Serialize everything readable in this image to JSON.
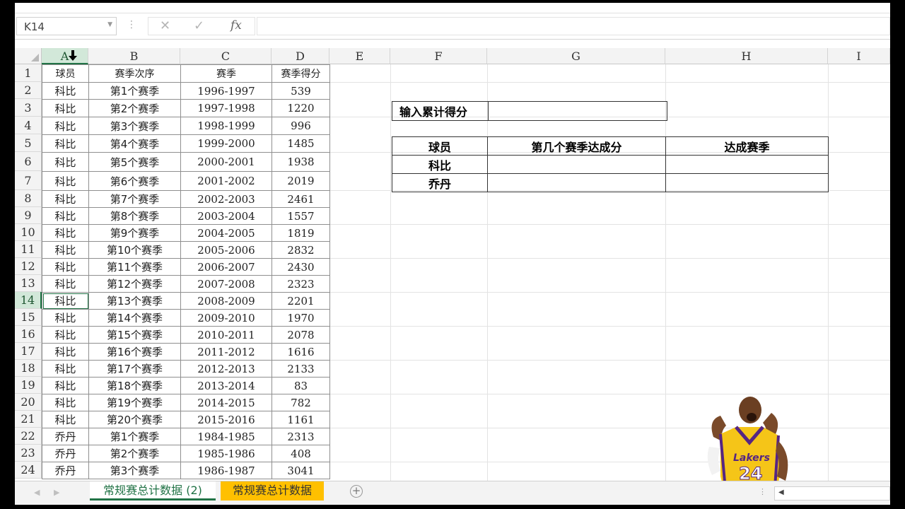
{
  "formula_bar": {
    "name_box": "K14",
    "cancel_glyph": "✕",
    "enter_glyph": "✓",
    "fx_label": "fx",
    "formula": ""
  },
  "columns": [
    "A",
    "B",
    "C",
    "D",
    "E",
    "F",
    "G",
    "H",
    "I"
  ],
  "selected_column": "A",
  "selected_row": 14,
  "rows": [
    "1",
    "2",
    "3",
    "4",
    "5",
    "6",
    "7",
    "8",
    "9",
    "10",
    "11",
    "12",
    "13",
    "14",
    "15",
    "16",
    "17",
    "18",
    "19",
    "20",
    "21",
    "22",
    "23",
    "24"
  ],
  "table": {
    "headers": [
      "球员",
      "赛季次序",
      "赛季",
      "赛季得分"
    ],
    "data": [
      [
        "科比",
        "第1个赛季",
        "1996-1997",
        "539"
      ],
      [
        "科比",
        "第2个赛季",
        "1997-1998",
        "1220"
      ],
      [
        "科比",
        "第3个赛季",
        "1998-1999",
        "996"
      ],
      [
        "科比",
        "第4个赛季",
        "1999-2000",
        "1485"
      ],
      [
        "科比",
        "第5个赛季",
        "2000-2001",
        "1938"
      ],
      [
        "科比",
        "第6个赛季",
        "2001-2002",
        "2019"
      ],
      [
        "科比",
        "第7个赛季",
        "2002-2003",
        "2461"
      ],
      [
        "科比",
        "第8个赛季",
        "2003-2004",
        "1557"
      ],
      [
        "科比",
        "第9个赛季",
        "2004-2005",
        "1819"
      ],
      [
        "科比",
        "第10个赛季",
        "2005-2006",
        "2832"
      ],
      [
        "科比",
        "第11个赛季",
        "2006-2007",
        "2430"
      ],
      [
        "科比",
        "第12个赛季",
        "2007-2008",
        "2323"
      ],
      [
        "科比",
        "第13个赛季",
        "2008-2009",
        "2201"
      ],
      [
        "科比",
        "第14个赛季",
        "2009-2010",
        "1970"
      ],
      [
        "科比",
        "第15个赛季",
        "2010-2011",
        "2078"
      ],
      [
        "科比",
        "第16个赛季",
        "2011-2012",
        "1616"
      ],
      [
        "科比",
        "第17个赛季",
        "2012-2013",
        "2133"
      ],
      [
        "科比",
        "第18个赛季",
        "2013-2014",
        "83"
      ],
      [
        "科比",
        "第19个赛季",
        "2014-2015",
        "782"
      ],
      [
        "科比",
        "第20个赛季",
        "2015-2016",
        "1161"
      ],
      [
        "乔丹",
        "第1个赛季",
        "1984-1985",
        "2313"
      ],
      [
        "乔丹",
        "第2个赛季",
        "1985-1986",
        "408"
      ],
      [
        "乔丹",
        "第3个赛季",
        "1986-1987",
        "3041"
      ]
    ]
  },
  "input_box": {
    "label": "输入累计得分",
    "value": ""
  },
  "result_table": {
    "headers": [
      "球员",
      "第几个赛季达成分",
      "达成赛季"
    ],
    "rows": [
      [
        "科比",
        "",
        ""
      ],
      [
        "乔丹",
        "",
        ""
      ]
    ]
  },
  "player_image": {
    "jersey_number": "24",
    "jersey_text": "Lakers",
    "jersey_color": "#f5c518",
    "trim_color": "#552583"
  },
  "sheet_tabs": [
    {
      "label": "常规赛总计数据 (2)",
      "active": true
    },
    {
      "label": "常规赛总计数据",
      "active": false,
      "color": "#ffc000"
    }
  ],
  "add_sheet_label": "+",
  "colors": {
    "accent": "#217346",
    "selection_fill": "#d2e8d9",
    "tab_highlight": "#ffc000"
  }
}
